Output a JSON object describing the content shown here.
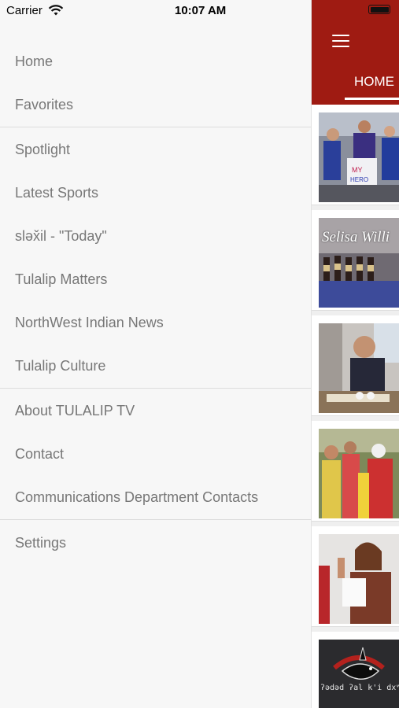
{
  "status_bar": {
    "carrier": "Carrier",
    "time": "10:07 AM"
  },
  "drawer": {
    "items": [
      {
        "label": "Home"
      },
      {
        "label": "Favorites"
      },
      {
        "label": "Spotlight"
      },
      {
        "label": "Latest Sports"
      },
      {
        "label": "sləx̌il - \"Today\""
      },
      {
        "label": "Tulalip Matters"
      },
      {
        "label": "NorthWest Indian News"
      },
      {
        "label": "Tulalip Culture"
      },
      {
        "label": "About TULALIP TV"
      },
      {
        "label": "Contact"
      },
      {
        "label": "Communications Department Contacts"
      },
      {
        "label": "Settings"
      }
    ]
  },
  "content": {
    "appbar_color": "#9f1b12",
    "tab_label": "HOME",
    "thumbnails": [
      {
        "icon": "crowd-photo"
      },
      {
        "icon": "dancers-photo",
        "overlay_text": "Selisa Willi"
      },
      {
        "icon": "man-with-papers-photo"
      },
      {
        "icon": "group-event-photo"
      },
      {
        "icon": "woman-oath-photo"
      },
      {
        "icon": "orca-logo-photo",
        "overlay_text": "ʔədəd ʔal k'i dxʷ"
      }
    ]
  }
}
